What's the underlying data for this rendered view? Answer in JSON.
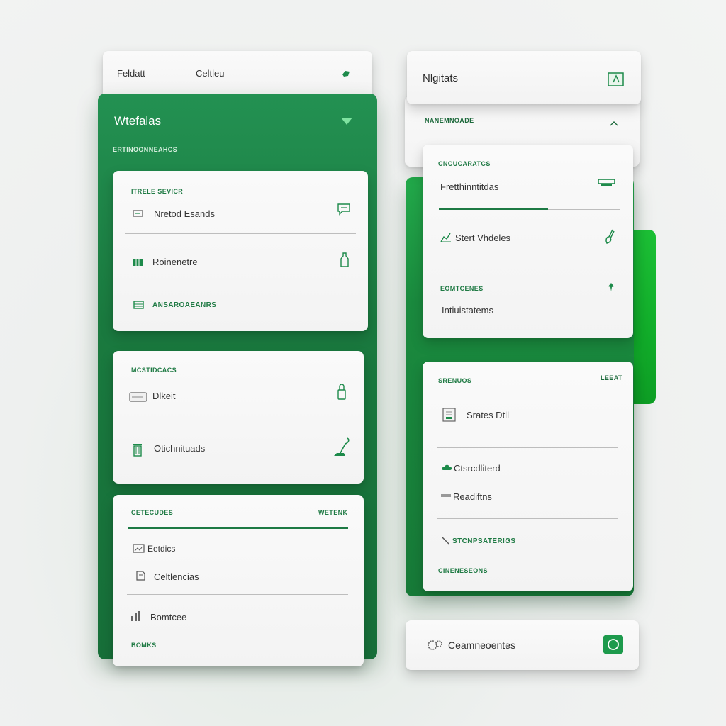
{
  "colors": {
    "primary_green": "#1d8a4a",
    "bright_green": "#16b82f",
    "card_bg": "#f6f6f6"
  },
  "left": {
    "top_card": {
      "tab1": "Feldatt",
      "tab2": "Celtleu"
    },
    "panel": {
      "title": "Wtefalas",
      "subtitle": "Ertinoonneahcs"
    },
    "card1": {
      "label": "Itrele Sevicr",
      "rows": [
        "Nretod Esands",
        "Roinenetre",
        "Ansaroaeanrs"
      ]
    },
    "card2": {
      "label": "Mcstidcacs",
      "rows": [
        "Dlkeit",
        "Otichnituads"
      ]
    },
    "card3": {
      "label": "Cetecudes",
      "right_label": "Wetenk",
      "rows": [
        "Eetdics",
        "Celtlencias",
        "Bomtcee"
      ],
      "footer": "Bomks"
    }
  },
  "right": {
    "top_card": {
      "title": "Nlgitats"
    },
    "sub_card": {
      "label": "Nanemnoade"
    },
    "card1": {
      "label": "Cncucaratcs",
      "rows": [
        "Fretthinntitdas",
        "Stert Vhdeles"
      ],
      "progress": 0.6,
      "label2": "Eomtcenes",
      "row3": "Intiuistatems"
    },
    "card2": {
      "label": "Srenuos",
      "right_label": "Leeat",
      "rows": [
        "Srates Dtll",
        "Ctsrcdliterd",
        "Readiftns",
        "Stcnpsaterigs"
      ],
      "footer": "Cineneseons"
    },
    "bottom_card": {
      "title": "Ceamneoentes"
    }
  }
}
